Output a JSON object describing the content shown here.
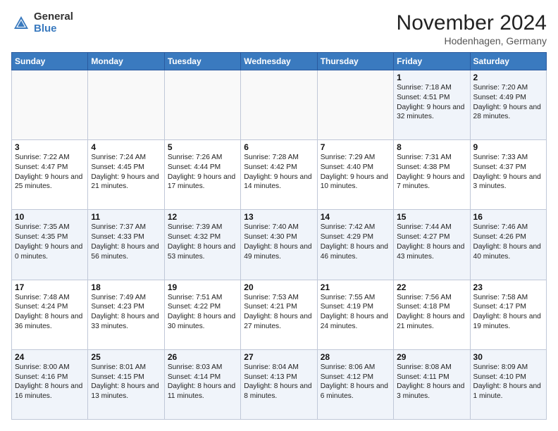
{
  "header": {
    "logo_general": "General",
    "logo_blue": "Blue",
    "month_title": "November 2024",
    "location": "Hodenhagen, Germany"
  },
  "weekdays": [
    "Sunday",
    "Monday",
    "Tuesday",
    "Wednesday",
    "Thursday",
    "Friday",
    "Saturday"
  ],
  "weeks": [
    [
      {
        "day": "",
        "info": ""
      },
      {
        "day": "",
        "info": ""
      },
      {
        "day": "",
        "info": ""
      },
      {
        "day": "",
        "info": ""
      },
      {
        "day": "",
        "info": ""
      },
      {
        "day": "1",
        "info": "Sunrise: 7:18 AM\nSunset: 4:51 PM\nDaylight: 9 hours\nand 32 minutes."
      },
      {
        "day": "2",
        "info": "Sunrise: 7:20 AM\nSunset: 4:49 PM\nDaylight: 9 hours\nand 28 minutes."
      }
    ],
    [
      {
        "day": "3",
        "info": "Sunrise: 7:22 AM\nSunset: 4:47 PM\nDaylight: 9 hours\nand 25 minutes."
      },
      {
        "day": "4",
        "info": "Sunrise: 7:24 AM\nSunset: 4:45 PM\nDaylight: 9 hours\nand 21 minutes."
      },
      {
        "day": "5",
        "info": "Sunrise: 7:26 AM\nSunset: 4:44 PM\nDaylight: 9 hours\nand 17 minutes."
      },
      {
        "day": "6",
        "info": "Sunrise: 7:28 AM\nSunset: 4:42 PM\nDaylight: 9 hours\nand 14 minutes."
      },
      {
        "day": "7",
        "info": "Sunrise: 7:29 AM\nSunset: 4:40 PM\nDaylight: 9 hours\nand 10 minutes."
      },
      {
        "day": "8",
        "info": "Sunrise: 7:31 AM\nSunset: 4:38 PM\nDaylight: 9 hours\nand 7 minutes."
      },
      {
        "day": "9",
        "info": "Sunrise: 7:33 AM\nSunset: 4:37 PM\nDaylight: 9 hours\nand 3 minutes."
      }
    ],
    [
      {
        "day": "10",
        "info": "Sunrise: 7:35 AM\nSunset: 4:35 PM\nDaylight: 9 hours\nand 0 minutes."
      },
      {
        "day": "11",
        "info": "Sunrise: 7:37 AM\nSunset: 4:33 PM\nDaylight: 8 hours\nand 56 minutes."
      },
      {
        "day": "12",
        "info": "Sunrise: 7:39 AM\nSunset: 4:32 PM\nDaylight: 8 hours\nand 53 minutes."
      },
      {
        "day": "13",
        "info": "Sunrise: 7:40 AM\nSunset: 4:30 PM\nDaylight: 8 hours\nand 49 minutes."
      },
      {
        "day": "14",
        "info": "Sunrise: 7:42 AM\nSunset: 4:29 PM\nDaylight: 8 hours\nand 46 minutes."
      },
      {
        "day": "15",
        "info": "Sunrise: 7:44 AM\nSunset: 4:27 PM\nDaylight: 8 hours\nand 43 minutes."
      },
      {
        "day": "16",
        "info": "Sunrise: 7:46 AM\nSunset: 4:26 PM\nDaylight: 8 hours\nand 40 minutes."
      }
    ],
    [
      {
        "day": "17",
        "info": "Sunrise: 7:48 AM\nSunset: 4:24 PM\nDaylight: 8 hours\nand 36 minutes."
      },
      {
        "day": "18",
        "info": "Sunrise: 7:49 AM\nSunset: 4:23 PM\nDaylight: 8 hours\nand 33 minutes."
      },
      {
        "day": "19",
        "info": "Sunrise: 7:51 AM\nSunset: 4:22 PM\nDaylight: 8 hours\nand 30 minutes."
      },
      {
        "day": "20",
        "info": "Sunrise: 7:53 AM\nSunset: 4:21 PM\nDaylight: 8 hours\nand 27 minutes."
      },
      {
        "day": "21",
        "info": "Sunrise: 7:55 AM\nSunset: 4:19 PM\nDaylight: 8 hours\nand 24 minutes."
      },
      {
        "day": "22",
        "info": "Sunrise: 7:56 AM\nSunset: 4:18 PM\nDaylight: 8 hours\nand 21 minutes."
      },
      {
        "day": "23",
        "info": "Sunrise: 7:58 AM\nSunset: 4:17 PM\nDaylight: 8 hours\nand 19 minutes."
      }
    ],
    [
      {
        "day": "24",
        "info": "Sunrise: 8:00 AM\nSunset: 4:16 PM\nDaylight: 8 hours\nand 16 minutes."
      },
      {
        "day": "25",
        "info": "Sunrise: 8:01 AM\nSunset: 4:15 PM\nDaylight: 8 hours\nand 13 minutes."
      },
      {
        "day": "26",
        "info": "Sunrise: 8:03 AM\nSunset: 4:14 PM\nDaylight: 8 hours\nand 11 minutes."
      },
      {
        "day": "27",
        "info": "Sunrise: 8:04 AM\nSunset: 4:13 PM\nDaylight: 8 hours\nand 8 minutes."
      },
      {
        "day": "28",
        "info": "Sunrise: 8:06 AM\nSunset: 4:12 PM\nDaylight: 8 hours\nand 6 minutes."
      },
      {
        "day": "29",
        "info": "Sunrise: 8:08 AM\nSunset: 4:11 PM\nDaylight: 8 hours\nand 3 minutes."
      },
      {
        "day": "30",
        "info": "Sunrise: 8:09 AM\nSunset: 4:10 PM\nDaylight: 8 hours\nand 1 minute."
      }
    ]
  ]
}
